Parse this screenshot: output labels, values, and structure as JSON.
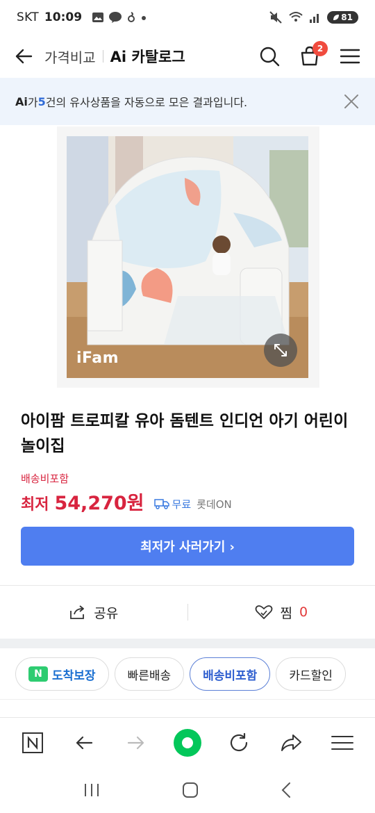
{
  "status": {
    "carrier": "SKT",
    "time": "10:09",
    "battery": "81"
  },
  "header": {
    "sub": "가격비교",
    "title": "Ai 카탈로그",
    "cart_count": "2"
  },
  "ai_banner": {
    "prefix": "Ai",
    "text_1": "가 ",
    "count": "5",
    "text_2": "건의 유사상품을 자동으로 모은 결과입니다."
  },
  "product": {
    "brand": "iFam",
    "title": "아이팜 트로피칼 유아 돔텐트 인디언 아기 어린이 놀이집",
    "shipping_note": "배송비포함",
    "price_label": "최저",
    "price_value": "54,270원",
    "free_ship": "무료",
    "seller": "롯데ON",
    "cta": "최저가 사러가기 ›"
  },
  "actions": {
    "share": "공유",
    "wish": "찜",
    "wish_count": "0"
  },
  "filters": [
    {
      "label": "도착보장"
    },
    {
      "label": "빠른배송"
    },
    {
      "label": "배송비포함"
    },
    {
      "label": "카드할인"
    }
  ],
  "browser_bar": {
    "n_label": "N"
  },
  "colors": {
    "accent_blue": "#4f7ef0",
    "price_red": "#d8243f",
    "naver_green": "#03c75a",
    "banner_bg": "#eef4fc"
  }
}
